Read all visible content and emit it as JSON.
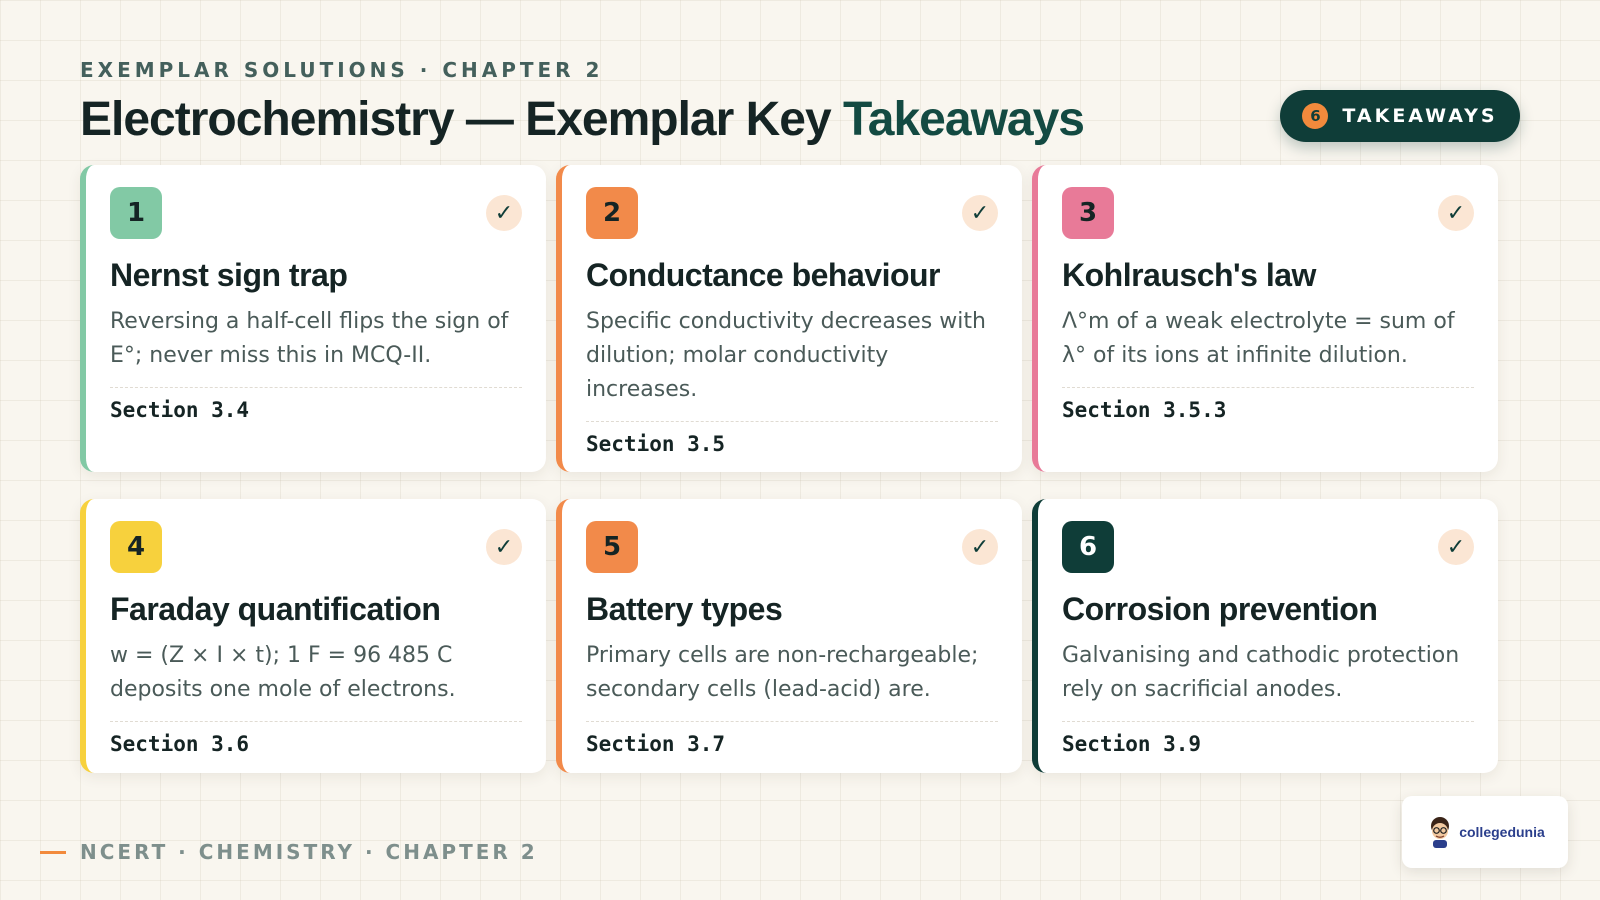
{
  "header": {
    "eyebrow": "EXEMPLAR SOLUTIONS · CHAPTER 2",
    "title_main": "Electrochemistry — Exemplar Key ",
    "title_accent": "Takeaways",
    "badge_count": "6",
    "badge_label": "TAKEAWAYS"
  },
  "cards": [
    {
      "number": "1",
      "color": "#82c9a5",
      "title": "Nernst sign trap",
      "text": "Reversing a half-cell flips the sign of E°; never miss this in MCQ-II.",
      "section": "Section 3.4",
      "check_icon": "check-icon"
    },
    {
      "number": "2",
      "color": "#f28a4a",
      "title": "Conductance behaviour",
      "text": "Specific conductivity decreases with dilution; molar conductivity increases.",
      "section": "Section 3.5",
      "check_icon": "check-icon"
    },
    {
      "number": "3",
      "color": "#e87a98",
      "title": "Kohlrausch's law",
      "text": "Λ°m of a weak electrolyte = sum of λ° of its ions at infinite dilution.",
      "section": "Section 3.5.3",
      "check_icon": "check-icon"
    },
    {
      "number": "4",
      "color": "#f7d13d",
      "title": "Faraday quantification",
      "text": "w = (Z × I × t); 1 F = 96 485 C deposits one mole of electrons.",
      "section": "Section 3.6",
      "check_icon": "check-icon"
    },
    {
      "number": "5",
      "color": "#f28a4a",
      "title": "Battery types",
      "text": "Primary cells are non-rechargeable; secondary cells (lead-acid) are.",
      "section": "Section 3.7",
      "check_icon": "check-icon"
    },
    {
      "number": "6",
      "color": "#0f3d38",
      "title": "Corrosion prevention",
      "text": "Galvanising and cathodic protection rely on sacrificial anodes.",
      "section": "Section 3.9",
      "check_icon": "check-icon"
    }
  ],
  "footer": {
    "text": "NCERT · CHEMISTRY · CHAPTER 2"
  },
  "logo": {
    "text": "collegedunia"
  }
}
